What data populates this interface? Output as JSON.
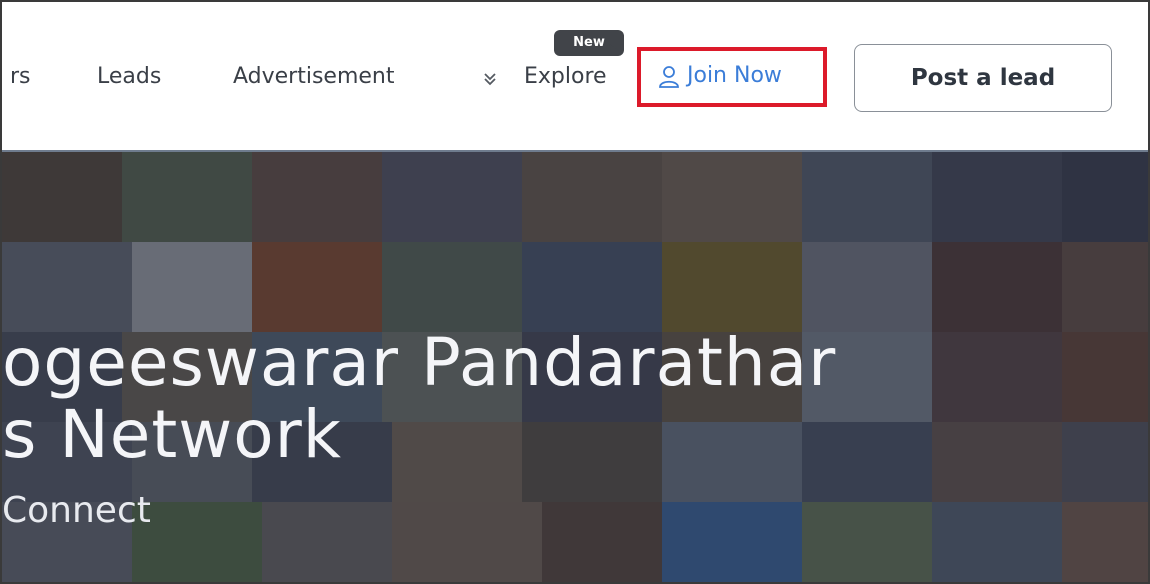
{
  "header": {
    "nav_partial": "rs",
    "nav_leads": "Leads",
    "nav_advertisement": "Advertisement",
    "nav_explore": "Explore",
    "new_badge": "New",
    "join_now": "Join Now",
    "post_lead": "Post a lead",
    "highlight_color": "#dc1a2a",
    "link_color": "#3b7dd8"
  },
  "hero": {
    "title_line1": "ogeeswarar Pandarathar",
    "title_line2": "s Network",
    "subtitle": "Connect"
  },
  "icons": {
    "explore": "double-chevron-down-icon",
    "join": "user-icon"
  }
}
